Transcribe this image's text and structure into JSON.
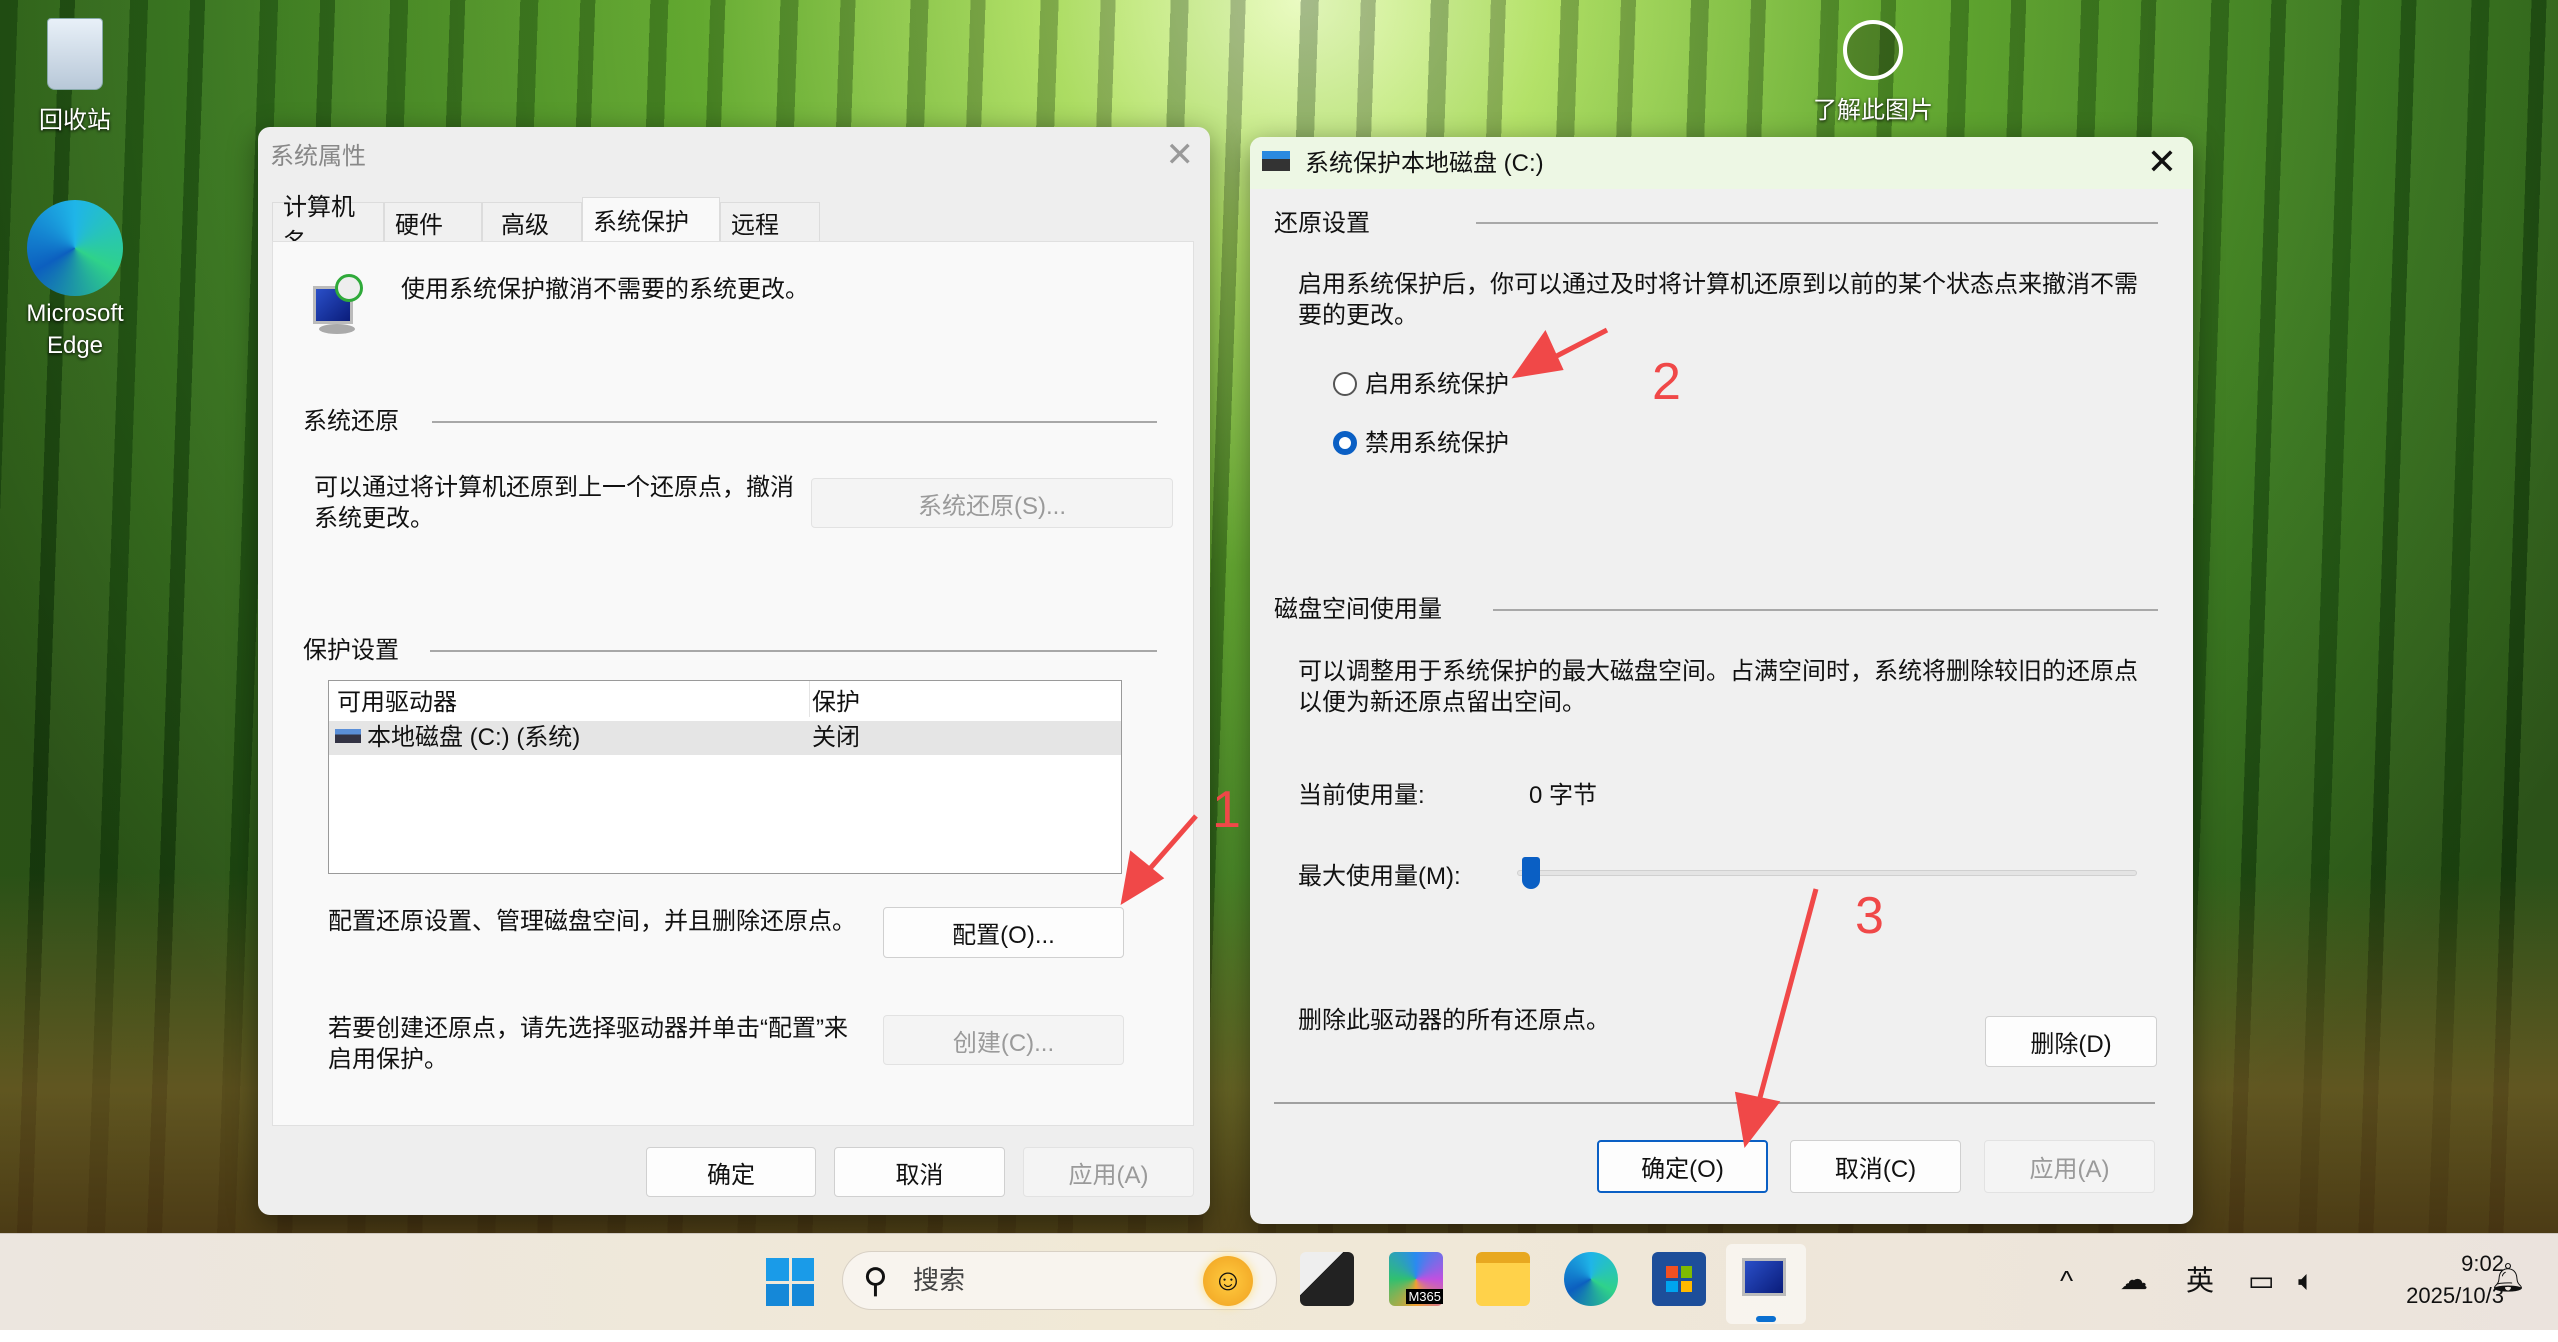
{
  "desktop": {
    "recycle_bin": "回收站",
    "edge": [
      "Microsoft",
      "Edge"
    ],
    "learn_image": "了解此图片"
  },
  "sys_props": {
    "title": "系统属性",
    "tabs": [
      "计算机名",
      "硬件",
      "高级",
      "系统保护",
      "远程"
    ],
    "intro": "使用系统保护撤消不需要的系统更改。",
    "restore_group": "系统还原",
    "restore_text": [
      "可以通过将计算机还原到上一个还原点，撤消",
      "系统更改。"
    ],
    "restore_button": "系统还原(S)...",
    "protect_group": "保护设置",
    "list_headers": [
      "可用驱动器",
      "保护"
    ],
    "list_rows": [
      {
        "drive": "本地磁盘 (C:) (系统)",
        "protection": "关闭"
      }
    ],
    "config_text": "配置还原设置、管理磁盘空间，并且删除还原点。",
    "config_button": "配置(O)...",
    "create_text": [
      "若要创建还原点，请先选择驱动器并单击“配置”来",
      "启用保护。"
    ],
    "create_button": "创建(C)...",
    "ok": "确定",
    "cancel": "取消",
    "apply": "应用(A)"
  },
  "protect_dlg": {
    "title": "系统保护本地磁盘 (C:)",
    "restore_group": "还原设置",
    "restore_text": [
      "启用系统保护后，你可以通过及时将计算机还原到以前的某个状态点来撤消不需",
      "要的更改。"
    ],
    "radio_enable": "启用系统保护",
    "radio_disable": "禁用系统保护",
    "selected": "禁用系统保护",
    "disk_group": "磁盘空间使用量",
    "disk_text": [
      "可以调整用于系统保护的最大磁盘空间。占满空间时，系统将删除较旧的还原点",
      "以便为新还原点留出空间。"
    ],
    "current_label": "当前使用量:",
    "current_value": "0 字节",
    "max_label": "最大使用量(M):",
    "max_usage_percent": 0,
    "delete_text": "删除此驱动器的所有还原点。",
    "delete_button": "删除(D)",
    "ok": "确定(O)",
    "cancel": "取消(C)",
    "apply": "应用(A)"
  },
  "annotations": [
    "1",
    "2",
    "3"
  ],
  "annotation_color": "#f04848",
  "taskbar": {
    "search": "搜索",
    "ime": "英",
    "time": "9:02",
    "date": "2025/10/3",
    "m365": "M365"
  }
}
